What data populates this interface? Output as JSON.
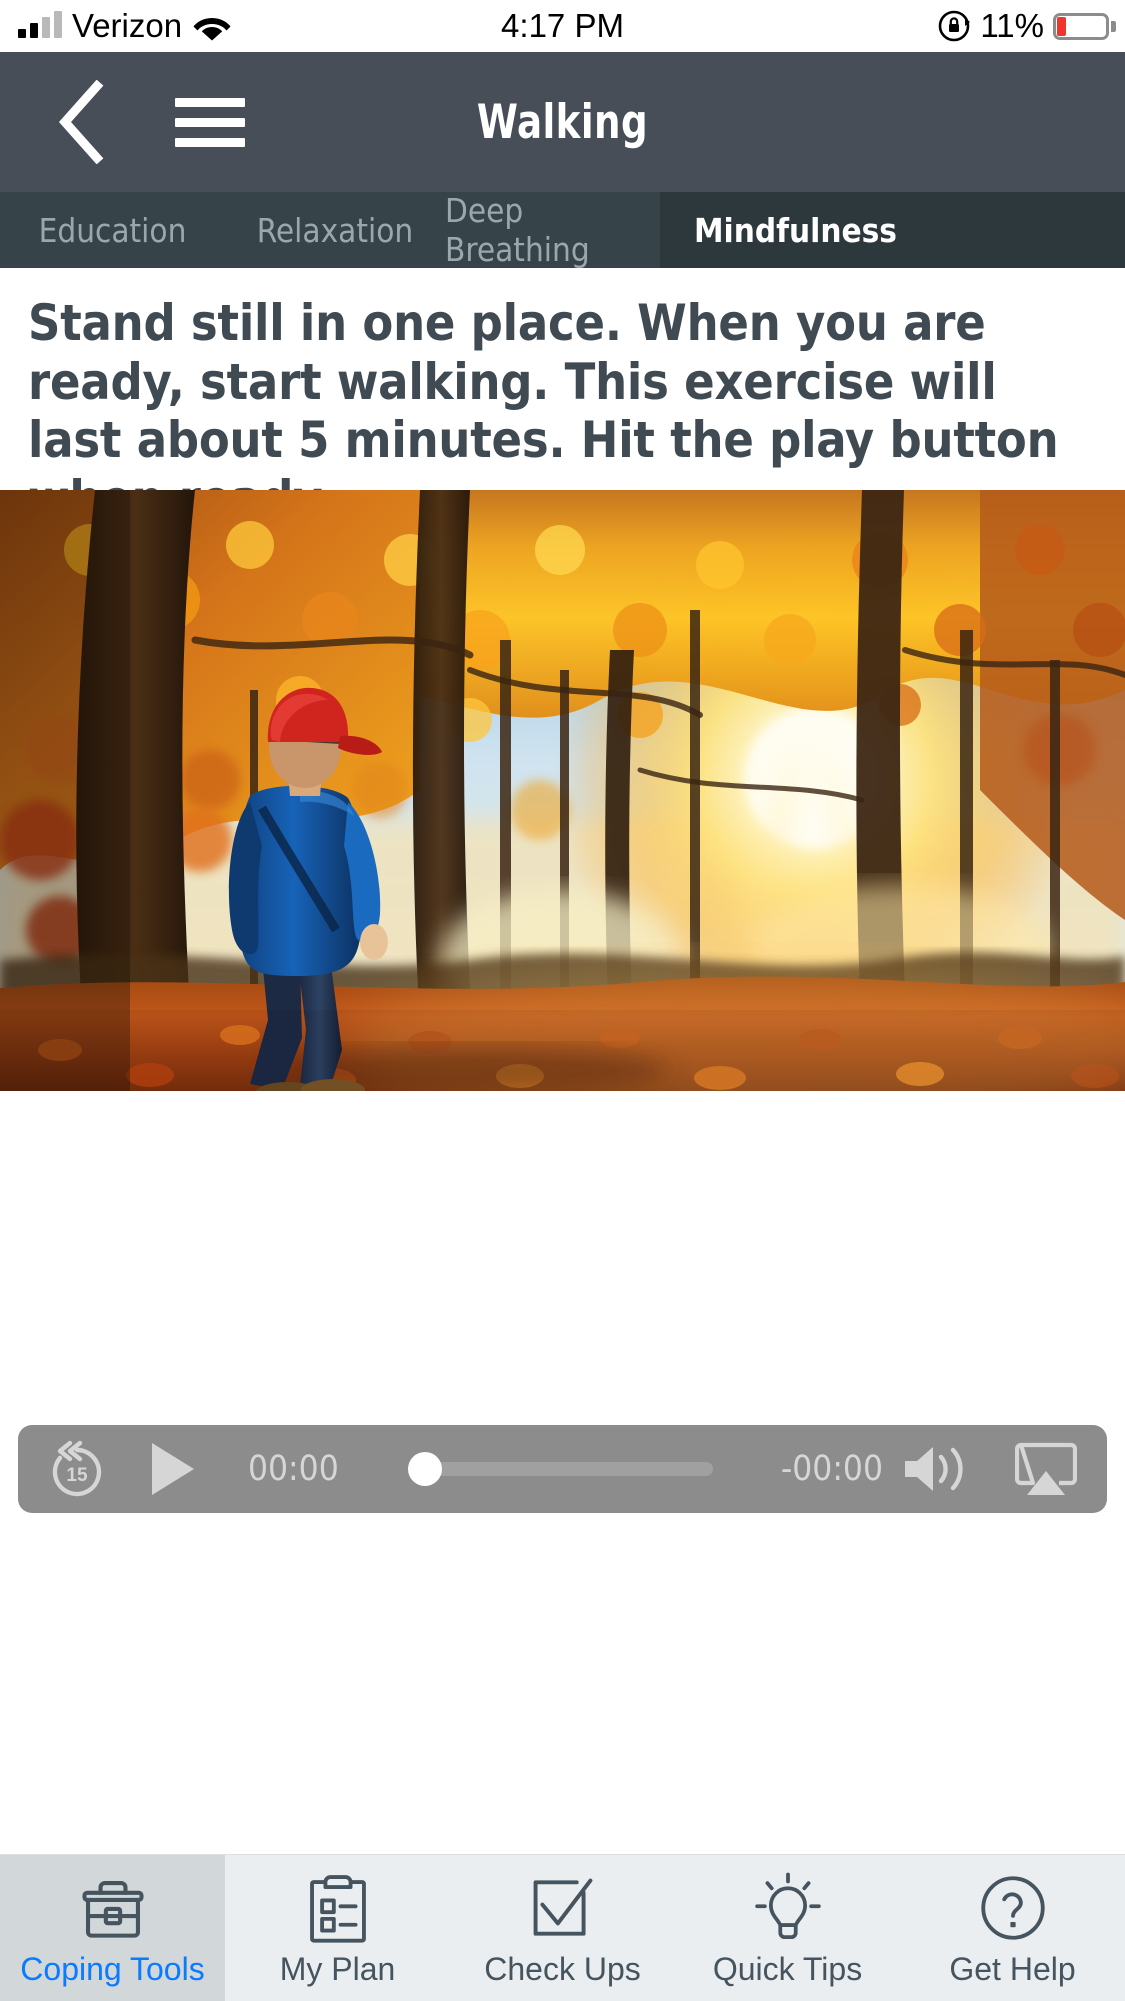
{
  "status_bar": {
    "carrier": "Verizon",
    "signal_icon": "cellular-bars-icon",
    "wifi_icon": "wifi-icon",
    "time": "4:17 PM",
    "orientation_lock_icon": "rotation-lock-icon",
    "battery_percent": "11%",
    "battery_icon": "battery-low-icon",
    "battery_color": "#f0342e"
  },
  "navbar": {
    "back_icon": "back-chevron-icon",
    "menu_icon": "hamburger-menu-icon",
    "title": "Walking",
    "background_color": "#474e57"
  },
  "tabs": {
    "background_color": "#36444a",
    "active_background_color": "#2d383d",
    "items": [
      {
        "label": "Education",
        "active": false
      },
      {
        "label": "Relaxation",
        "active": false
      },
      {
        "label": "Deep Breathing",
        "active": false
      },
      {
        "label": "Mindfulness",
        "active": true
      }
    ]
  },
  "instruction": {
    "text": "Stand still in one place. When you are ready, start walking. This exercise will last about 5 minutes. Hit the play button when ready.",
    "text_color": "#3f4a52"
  },
  "photo": {
    "alt": "Man in blue jacket and red cap walking on a leaf-covered forest path with autumn foliage and sun rays"
  },
  "player": {
    "background_color": "#8c8c8c",
    "rewind_icon": "rewind-15-icon",
    "rewind_seconds": "15",
    "play_icon": "play-icon",
    "elapsed_time": "00:00",
    "remaining_time": "-00:00",
    "progress_percent": 0,
    "volume_icon": "volume-icon",
    "airplay_icon": "airplay-icon"
  },
  "bottom_tabbar": {
    "background_color": "#eaeef0",
    "active_background_color": "#d2d7da",
    "active_label_color": "#0a7bff",
    "label_color": "#46545f",
    "items": [
      {
        "label": "Coping Tools",
        "icon": "toolbox-icon",
        "active": true
      },
      {
        "label": "My Plan",
        "icon": "clipboard-checklist-icon",
        "active": false
      },
      {
        "label": "Check Ups",
        "icon": "checkbox-check-icon",
        "active": false
      },
      {
        "label": "Quick Tips",
        "icon": "lightbulb-icon",
        "active": false
      },
      {
        "label": "Get Help",
        "icon": "question-circle-icon",
        "active": false
      }
    ]
  }
}
